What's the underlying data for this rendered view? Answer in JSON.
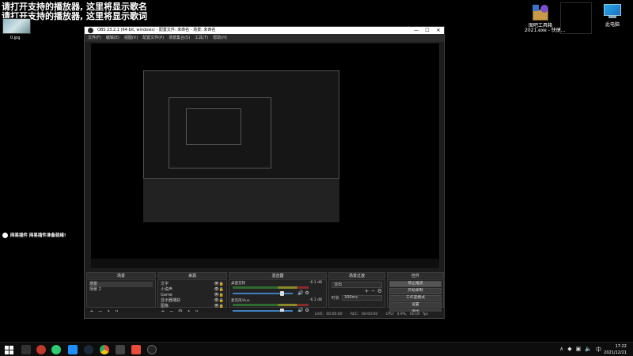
{
  "desktop": {
    "lyric_line1": "请打开支持的播放器, 这里将显示歌名",
    "lyric_line2": "请打开支持的播放器, 这里将显示歌词",
    "thumb_label": "0.jpg",
    "plugin_status": "网易插件 网易插件准备就绪!",
    "icons": [
      {
        "label": "图吧工具箱\n2021.exe - 快捷...",
        "icon": "toolbox-icon"
      },
      {
        "label": "",
        "icon": "blank-icon"
      },
      {
        "label": "此电脑",
        "icon": "computer-icon"
      }
    ]
  },
  "obs": {
    "title": "OBS 23.2.1 (64-bit, windows) - 配置文件: 未命名 - 场景: 未命名",
    "menu": [
      "文件(F)",
      "编辑(E)",
      "视图(V)",
      "配置文件(P)",
      "场景集合(S)",
      "工具(T)",
      "帮助(H)"
    ],
    "docks": {
      "scenes": {
        "title": "场景",
        "items": [
          "场景",
          "场景 2"
        ]
      },
      "sources": {
        "title": "来源",
        "items": [
          "文字",
          "小说声",
          "Game",
          "显示器捕获",
          "图像"
        ]
      },
      "mixer": {
        "title": "混音器",
        "channels": [
          {
            "name": "桌面音频",
            "db": "-6.1 dB"
          },
          {
            "name": "麦克风/Aux",
            "db": "-6.1 dB"
          }
        ]
      },
      "transitions": {
        "title": "场景过渡",
        "type": "淡出",
        "duration_label": "时长",
        "duration_value": "300ms"
      },
      "controls": {
        "title": "控件",
        "buttons": [
          "停止推流",
          "开始录制",
          "工作室模式",
          "设置",
          "退出"
        ]
      }
    },
    "status": {
      "live": "LIVE: 00:00:00",
      "rec": "REC: 00:00:00",
      "cpu": "CPU: 4.9%, 60.00 fps"
    }
  },
  "taskbar": {
    "time": "17:22",
    "date": "2021/12/21"
  }
}
